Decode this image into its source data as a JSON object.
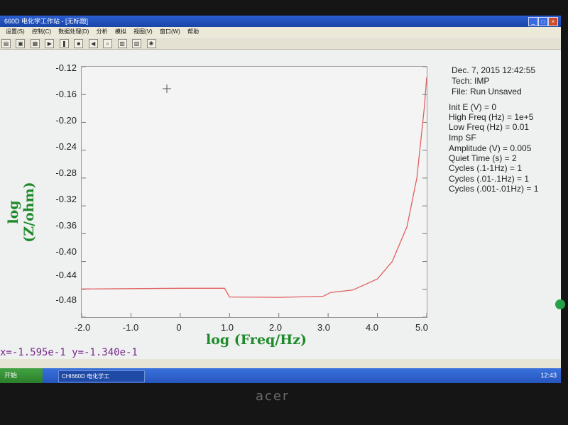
{
  "window": {
    "title": "660D 电化学工作站 - [无标题]",
    "buttons": [
      "_",
      "□",
      "×"
    ]
  },
  "menu": [
    "设置(S)",
    "控制(C)",
    "数据处理(D)",
    "分析",
    "模拟",
    "视图(V)",
    "窗口(W)",
    "帮助"
  ],
  "toolbar_icons": [
    "open-icon",
    "save-icon",
    "print-icon",
    "run-icon",
    "pause-icon",
    "stop-icon",
    "reverse-icon",
    "zoom-icon",
    "graph-icon",
    "overlay-icon",
    "settings-icon"
  ],
  "chart_data": {
    "type": "line",
    "xlabel": "log (Freq/Hz)",
    "ylabel": "log (Z/ohm)",
    "xlim": [
      -2.0,
      5.0
    ],
    "ylim": [
      -0.48,
      -0.12
    ],
    "x_ticks": [
      "-2.0",
      "-1.0",
      "0",
      "1.0",
      "2.0",
      "3.0",
      "4.0",
      "5.0"
    ],
    "y_ticks": [
      "-0.12",
      "-0.16",
      "-0.20",
      "-0.24",
      "-0.28",
      "-0.32",
      "-0.36",
      "-0.40",
      "-0.44",
      "-0.48"
    ],
    "series": [
      {
        "color": "#e06060",
        "x": [
          -2.0,
          -1.0,
          0.0,
          0.9,
          1.0,
          2.0,
          2.9,
          3.05,
          3.5,
          4.0,
          4.3,
          4.6,
          4.8,
          4.95,
          5.0
        ],
        "y": [
          -0.4395,
          -0.439,
          -0.4385,
          -0.4385,
          -0.451,
          -0.4515,
          -0.45,
          -0.4445,
          -0.441,
          -0.425,
          -0.4,
          -0.35,
          -0.28,
          -0.18,
          -0.135
        ]
      }
    ]
  },
  "info_panel": {
    "date_time": "Dec. 7, 2015    12:42:55",
    "tech": "Tech: IMP",
    "file": "File: Run Unsaved",
    "params": [
      "Init E (V) = 0",
      "High Freq (Hz) = 1e+5",
      "Low Freq (Hz) = 0.01",
      "Imp SF",
      "Amplitude (V) = 0.005",
      "Quiet Time (s) = 2",
      "Cycles (.1-1Hz) = 1",
      "Cycles (.01-.1Hz) = 1",
      "Cycles (.001-.01Hz) = 1"
    ]
  },
  "cursor_readout": "x=-1.595e-1   y=-1.340e-1",
  "taskbar": {
    "start_label": "开始",
    "task_label": "CHI660D 电化学工",
    "clock": "12:43"
  },
  "monitor_brand": "acer"
}
